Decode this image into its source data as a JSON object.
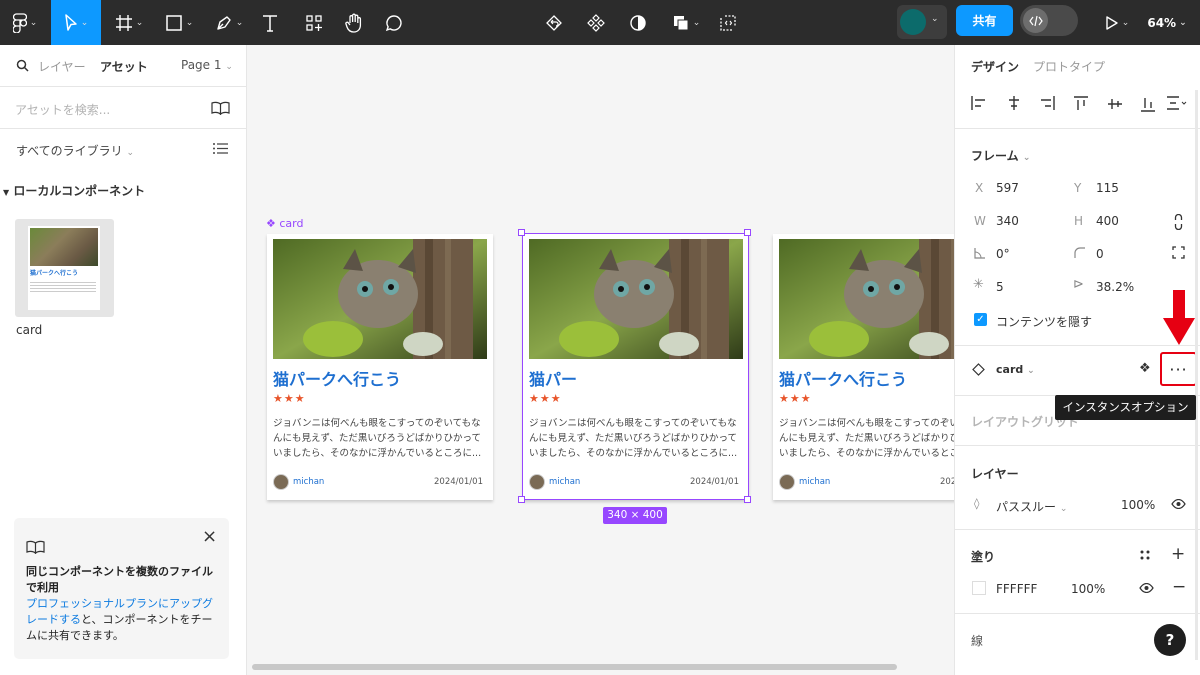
{
  "toolbar": {
    "share_label": "共有",
    "zoom_label": "64%",
    "avatar_color": "#0c6b6b",
    "accent": "#0d99ff"
  },
  "left_panel": {
    "tab_layers": "レイヤー",
    "tab_assets": "アセット",
    "page_label": "Page 1",
    "search_placeholder": "アセットを検索...",
    "library_label": "すべてのライブラリ",
    "local_components": "ローカルコンポーネント",
    "component_name": "card",
    "thumb_title": "猫パークへ行こう",
    "promo": {
      "line1": "同じコンポーネントを複数のファイルで利用",
      "link": "プロフェッショナルプランにアップグレードする",
      "line2": "と、コンポーネントをチームに共有できます。"
    }
  },
  "canvas": {
    "frame_label": "card",
    "size_badge": "340 × 400",
    "cards": [
      {
        "title": "猫パークへ行こう",
        "stars": "★★★",
        "body": "ジョバンニは何べんも眼をこすってのぞいてもなんにも見えず、ただ黒いびろうどばかりひかっていましたら、そのなかに浮かんでいるところに...",
        "user": "michan",
        "date": "2024/01/01"
      },
      {
        "title": "猫パー",
        "stars": "★★★",
        "body": "ジョバンニは何べんも眼をこすってのぞいてもなんにも見えず、ただ黒いびろうどばかりひかっていましたら、そのなかに浮かんでいるところに...",
        "user": "michan",
        "date": "2024/01/01"
      },
      {
        "title": "猫パークへ行こう",
        "stars": "★★★",
        "body": "ジョバンニは何べんも眼をこすってのぞいてもなんにも見えず、ただ黒いびろうどばかりひかっていましたら、そのなかに浮かんでいるところに...",
        "user": "michan",
        "date": "2024/01/01"
      }
    ]
  },
  "right_panel": {
    "tab_design": "デザイン",
    "tab_prototype": "プロトタイプ",
    "frame_label": "フレーム",
    "x_label": "X",
    "x_value": "597",
    "y_label": "Y",
    "y_value": "115",
    "w_label": "W",
    "w_value": "340",
    "h_label": "H",
    "h_value": "400",
    "rotation": "0°",
    "radius": "0",
    "stroke_weight": "5",
    "ratio": "38.2%",
    "clip_label": "コンテンツを隠す",
    "instance_name": "card",
    "tooltip": "インスタンスオプション",
    "layout_grid": "レイアウトグリッド",
    "layer_label": "レイヤー",
    "blend_mode": "パススルー",
    "layer_opacity": "100%",
    "fill_label": "塗り",
    "fill_hex": "FFFFFF",
    "fill_opacity": "100%",
    "stroke_label": "線"
  }
}
